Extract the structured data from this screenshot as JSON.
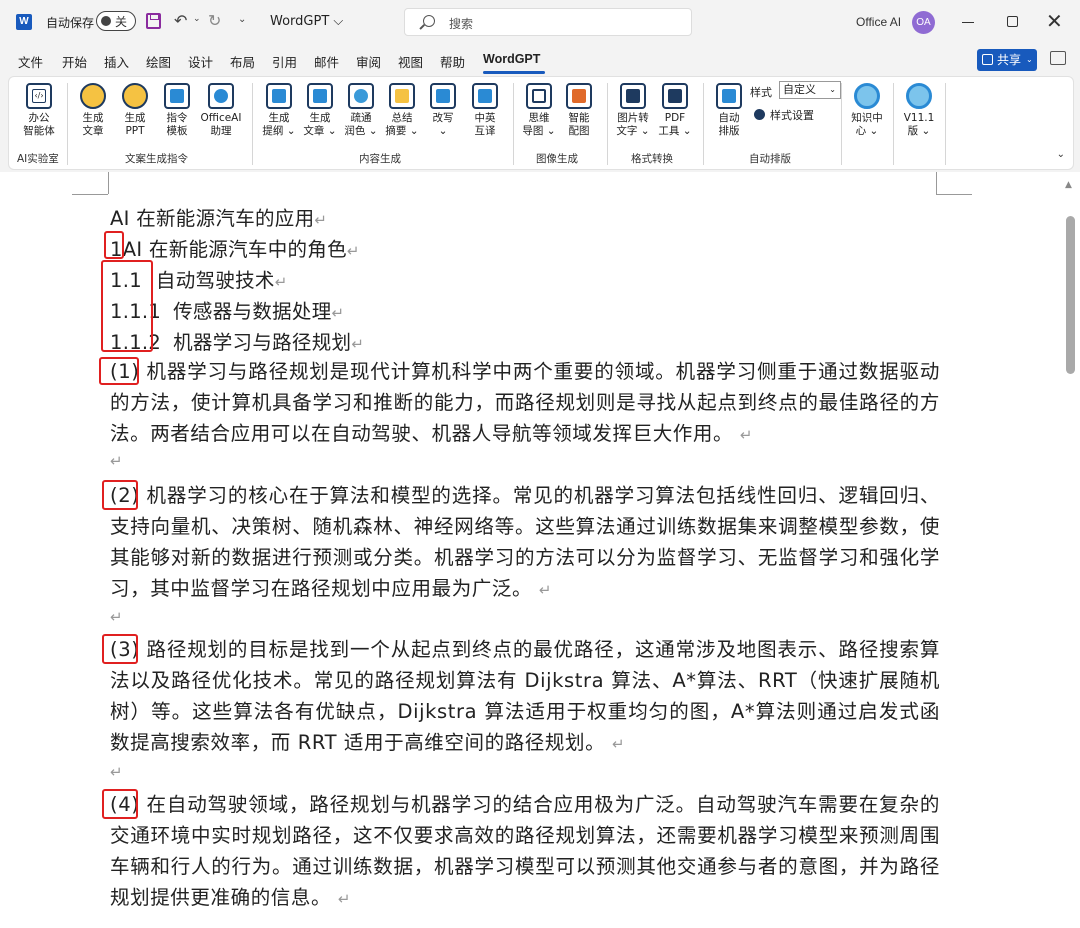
{
  "titlebar": {
    "autosave_label": "自动保存",
    "autosave_state": "关",
    "undo_icon": "↶",
    "redo_icon": "↻",
    "doc_name": "WordGPT ⌵",
    "search_placeholder": "搜索",
    "user_name": "Office AI",
    "user_initials": "OA",
    "word_logo": "W"
  },
  "menu": {
    "tabs": [
      "文件",
      "开始",
      "插入",
      "绘图",
      "设计",
      "布局",
      "引用",
      "邮件",
      "审阅",
      "视图",
      "帮助",
      "WordGPT"
    ],
    "share_label": "共享"
  },
  "ribbon": {
    "buttons": [
      {
        "label": "办公\n智能体",
        "icon": "code-icon"
      },
      {
        "label": "生成\n文章",
        "icon": "bulb-icon"
      },
      {
        "label": "生成\nPPT",
        "icon": "bulb-ppt-icon"
      },
      {
        "label": "指令\n模板",
        "icon": "template-icon"
      },
      {
        "label": "OfficeAI\n助理",
        "icon": "robot-icon"
      },
      {
        "label": "生成\n提纲 ⌄",
        "icon": "outline-icon"
      },
      {
        "label": "生成\n文章 ⌄",
        "icon": "text-icon"
      },
      {
        "label": "疏通\n润色 ⌄",
        "icon": "globe-icon"
      },
      {
        "label": "总结\n摘要 ⌄",
        "icon": "summary-icon"
      },
      {
        "label": "改写\n⌄",
        "icon": "rewrite-icon"
      },
      {
        "label": "中英\n互译",
        "icon": "translate-icon"
      },
      {
        "label": "思维\n导图 ⌄",
        "icon": "mindmap-icon"
      },
      {
        "label": "智能\n配图",
        "icon": "image-icon"
      },
      {
        "label": "图片转\n文字 ⌄",
        "icon": "ocr-icon"
      },
      {
        "label": "PDF\n工具 ⌄",
        "icon": "pdf-icon"
      },
      {
        "label": "自动\n排版",
        "icon": "layout-icon"
      },
      {
        "label": "知识中\n心 ⌄",
        "icon": "knowledge-icon"
      },
      {
        "label": "V11.1\n版 ⌄",
        "icon": "version-icon"
      }
    ],
    "groups": [
      "AI实验室",
      "文案生成指令",
      "内容生成",
      "图像生成",
      "格式转换",
      "自动排版"
    ],
    "style_label": "样式",
    "style_value": "自定义",
    "style_settings": "样式设置"
  },
  "document": {
    "title_line": "AI 在新能源汽车的应用",
    "heading1_num": "1",
    "heading1_text": "AI 在新能源汽车中的角色",
    "heading2_num": "1.1",
    "heading2_text": "自动驾驶技术",
    "heading3a_num": "1.1.1",
    "heading3a_text": "传感器与数据处理",
    "heading3b_num": "1.1.2",
    "heading3b_text": "机器学习与路径规划",
    "para_mark": "↵",
    "paragraphs": [
      {
        "num": "(1)",
        "text": "机器学习与路径规划是现代计算机科学中两个重要的领域。机器学习侧重于通过数据驱动的方法，使计算机具备学习和推断的能力，而路径规划则是寻找从起点到终点的最佳路径的方法。两者结合应用可以在自动驾驶、机器人导航等领域发挥巨大作用。"
      },
      {
        "num": "(2)",
        "text": "机器学习的核心在于算法和模型的选择。常见的机器学习算法包括线性回归、逻辑回归、支持向量机、决策树、随机森林、神经网络等。这些算法通过训练数据集来调整模型参数，使其能够对新的数据进行预测或分类。机器学习的方法可以分为监督学习、无监督学习和强化学习，其中监督学习在路径规划中应用最为广泛。"
      },
      {
        "num": "(3)",
        "text": "路径规划的目标是找到一个从起点到终点的最优路径，这通常涉及地图表示、路径搜索算法以及路径优化技术。常见的路径规划算法有 Dijkstra 算法、A*算法、RRT（快速扩展随机树）等。这些算法各有优缺点，Dijkstra 算法适用于权重均匀的图，A*算法则通过启发式函数提高搜索效率，而 RRT 适用于高维空间的路径规划。"
      },
      {
        "num": "(4)",
        "text": "在自动驾驶领域，路径规划与机器学习的结合应用极为广泛。自动驾驶汽车需要在复杂的交通环境中实时规划路径，这不仅要求高效的路径规划算法，还需要机器学习模型来预测周围车辆和行人的行为。通过训练数据，机器学习模型可以预测其他交通参与者的意图，并为路径规划提供更准确的信息。"
      }
    ]
  },
  "colors": {
    "accent": "#185abd",
    "highlight_box": "#e02020",
    "ribbon_icon": "#1e3a5f"
  }
}
